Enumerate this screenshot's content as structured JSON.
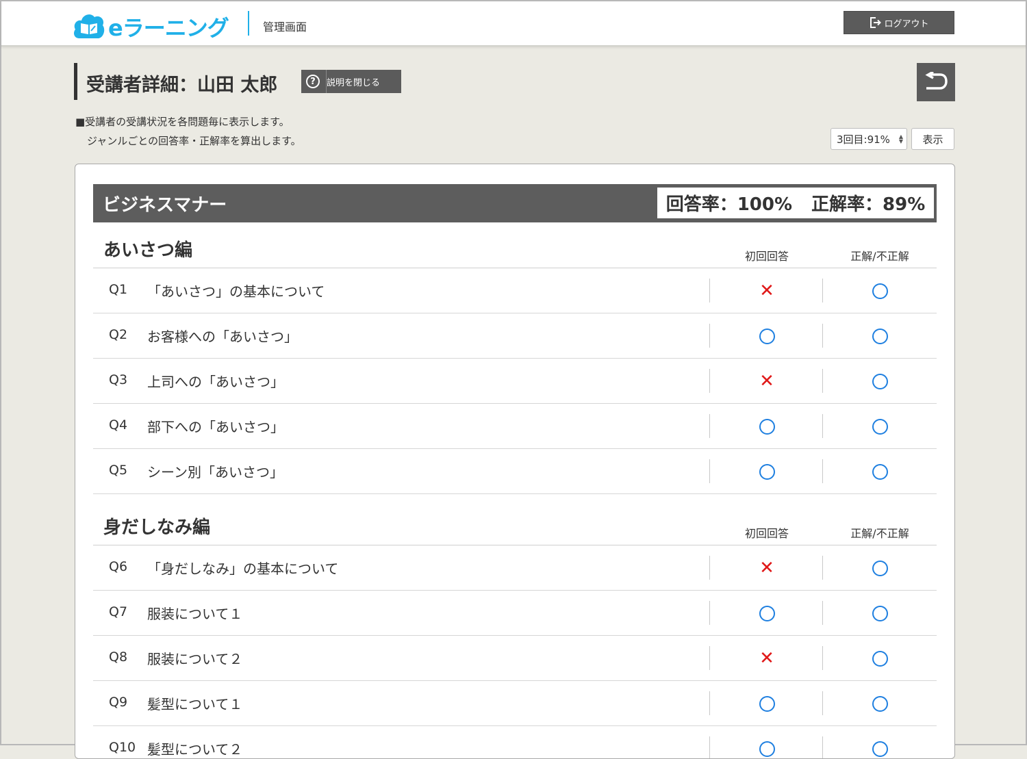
{
  "header": {
    "brand": "eラーニング",
    "subtitle": "管理画面",
    "logout_label": "ログアウト"
  },
  "page": {
    "title": "受講者詳細：山田 太郎",
    "help_label": "説明を閉じる",
    "help_glyph": "?",
    "description_line1": "■受講者の受講状況を各問題毎に表示します。",
    "description_line2": "ジャンルごとの回答率・正解率を算出します。"
  },
  "filter": {
    "selected": "3回目:91%",
    "show_label": "表示"
  },
  "genre": {
    "name": "ビジネスマナー",
    "answer_rate": "回答率：100%",
    "correct_rate": "正解率：89%"
  },
  "columns": {
    "first": "初回回答",
    "final": "正解/不正解"
  },
  "sections": [
    {
      "title": "あいさつ編",
      "rows": [
        {
          "num": "Q1",
          "text": "「あいさつ」の基本について",
          "first": "x",
          "final": "o"
        },
        {
          "num": "Q2",
          "text": "お客様への「あいさつ」",
          "first": "o",
          "final": "o"
        },
        {
          "num": "Q3",
          "text": "上司への「あいさつ」",
          "first": "x",
          "final": "o"
        },
        {
          "num": "Q4",
          "text": "部下への「あいさつ」",
          "first": "o",
          "final": "o"
        },
        {
          "num": "Q5",
          "text": "シーン別「あいさつ」",
          "first": "o",
          "final": "o"
        }
      ]
    },
    {
      "title": "身だしなみ編",
      "rows": [
        {
          "num": "Q6",
          "text": "「身だしなみ」の基本について",
          "first": "x",
          "final": "o"
        },
        {
          "num": "Q7",
          "text": "服装について１",
          "first": "o",
          "final": "o"
        },
        {
          "num": "Q8",
          "text": "服装について２",
          "first": "x",
          "final": "o"
        },
        {
          "num": "Q9",
          "text": "髪型について１",
          "first": "o",
          "final": "o"
        },
        {
          "num": "Q10",
          "text": "髪型について２",
          "first": "o",
          "final": "o"
        }
      ]
    }
  ],
  "colors": {
    "accent": "#20b0e8",
    "correct": "#1e7fe0",
    "incorrect": "#e01818",
    "dark_button": "#5b5b5b"
  }
}
